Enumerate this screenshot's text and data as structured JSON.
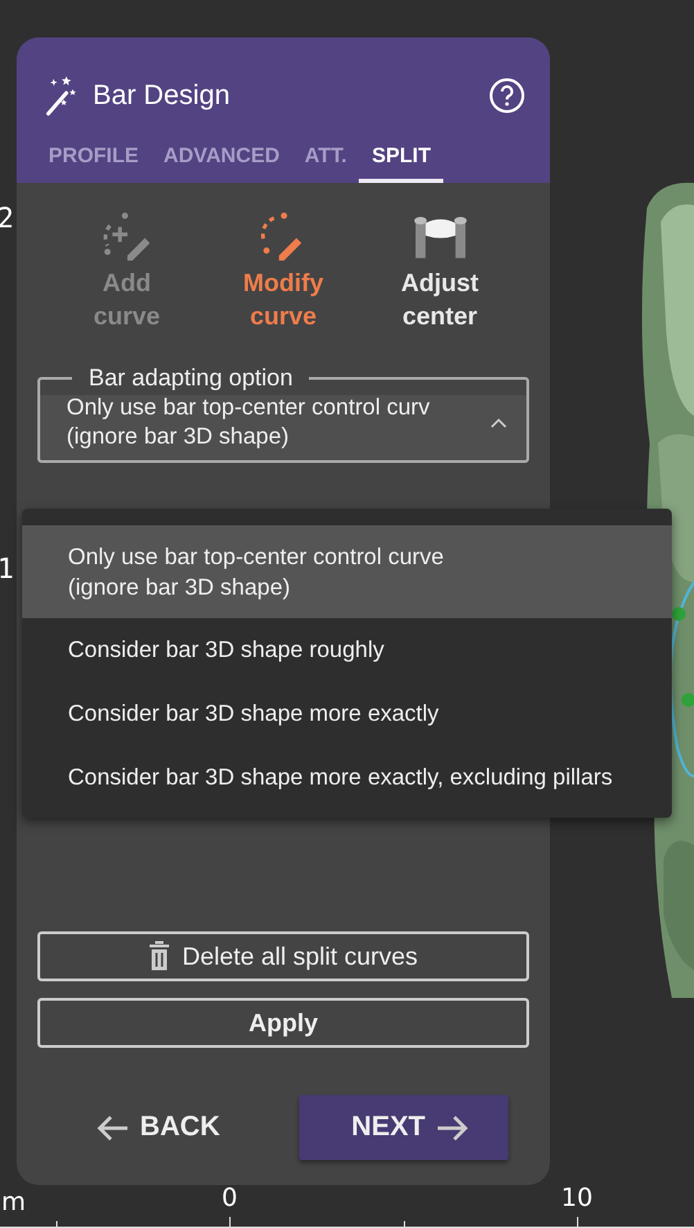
{
  "viewport": {
    "left_labels": [
      "2",
      "1"
    ],
    "bottom_labels": [
      "m",
      "0",
      "10"
    ]
  },
  "panel": {
    "title": "Bar Design",
    "tabs": [
      {
        "label": "PROFILE",
        "selected": false
      },
      {
        "label": "ADVANCED",
        "selected": false
      },
      {
        "label": "ATT.",
        "selected": false
      },
      {
        "label": "SPLIT",
        "selected": true
      }
    ],
    "tools": [
      {
        "kind": "add",
        "label": "Add\ncurve",
        "selected": false,
        "disabled": true
      },
      {
        "kind": "modify",
        "label": "Modify\ncurve",
        "selected": true,
        "disabled": false
      },
      {
        "kind": "center",
        "label": "Adjust\ncenter",
        "selected": false,
        "disabled": false
      }
    ],
    "select": {
      "label": "Bar adapting option",
      "value": "Only use bar top-center control curv\n(ignore bar 3D shape)",
      "expanded": true
    },
    "menu": [
      {
        "label": "Only use bar top-center control curve\n(ignore bar 3D shape)",
        "selected": true
      },
      {
        "label": "Consider bar 3D shape roughly",
        "selected": false
      },
      {
        "label": "Consider bar 3D shape more exactly",
        "selected": false
      },
      {
        "label": "Consider bar 3D shape more exactly, excluding pillars",
        "selected": false
      }
    ],
    "delete_button": "Delete all split curves",
    "apply_button": "Apply",
    "back_button": "BACK",
    "next_button": "NEXT"
  }
}
